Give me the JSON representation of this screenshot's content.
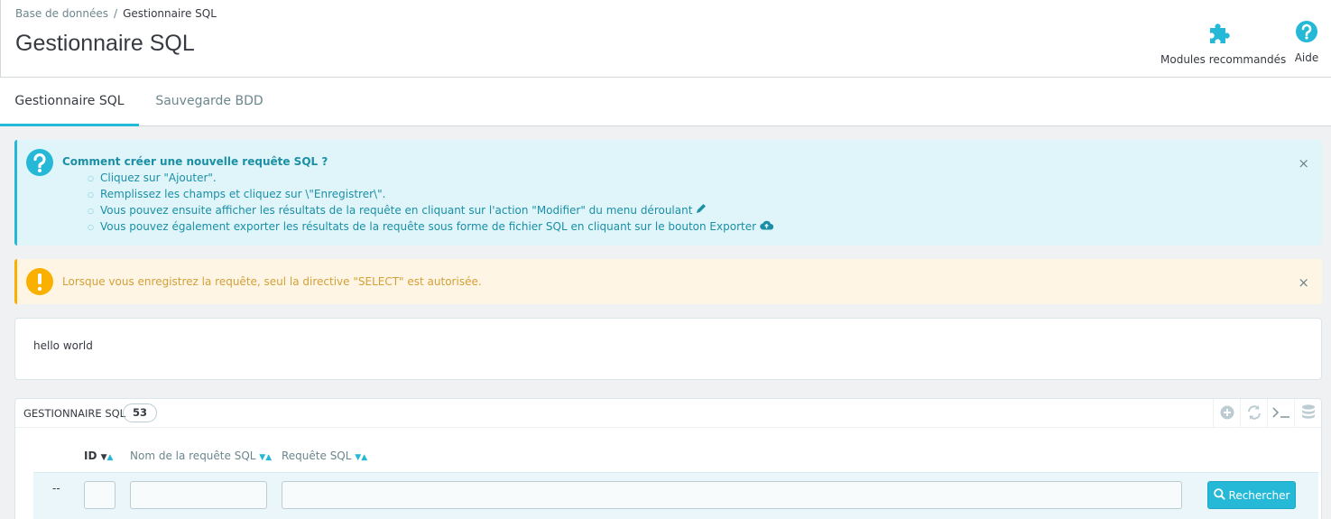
{
  "breadcrumb": {
    "parent": "Base de données",
    "separator": "/",
    "current": "Gestionnaire SQL"
  },
  "header": {
    "title": "Gestionnaire SQL"
  },
  "toolbar": {
    "modules_label": "Modules recommandés",
    "help_label": "Aide"
  },
  "tabs": [
    {
      "label": "Gestionnaire SQL",
      "active": true
    },
    {
      "label": "Sauvegarde BDD",
      "active": false
    }
  ],
  "info_alert": {
    "title": "Comment créer une nouvelle requête SQL ?",
    "items": [
      "Cliquez sur \"Ajouter\".",
      "Remplissez les champs et cliquez sur \\\"Enregistrer\\\".",
      "Vous pouvez ensuite afficher les résultats de la requête en cliquant sur l'action \"Modifier\" du menu déroulant",
      "Vous pouvez également exporter les résultats de la requête sous forme de fichier SQL en cliquant sur le bouton Exporter"
    ],
    "close": "×"
  },
  "warning_alert": {
    "text": "Lorsque vous enregistrez la requête, seul la directive \"SELECT\" est autorisée.",
    "close": "×"
  },
  "message_card": {
    "text": "hello world"
  },
  "list": {
    "title": "Gestionnaire SQL",
    "count": "53",
    "columns": {
      "id": "ID",
      "name": "Nom de la requête SQL",
      "query": "Requête SQL"
    },
    "filter_dash": "--",
    "search_label": "Rechercher"
  },
  "colors": {
    "accent": "#25b9d7",
    "info_bg": "#dff5f9",
    "warning_bg": "#fff5e5",
    "warning": "#fab000"
  }
}
